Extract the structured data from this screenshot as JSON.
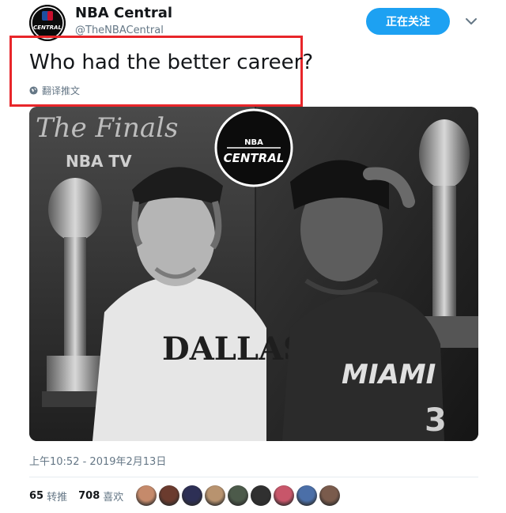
{
  "profile": {
    "display_name": "NBA Central",
    "handle": "@TheNBACentral",
    "avatar_text": "CENTRAL",
    "avatar_logo": "NBA"
  },
  "follow_button": {
    "label": "正在关注"
  },
  "menu": {
    "icon": "chevron-down-icon"
  },
  "tweet": {
    "text": "Who had the better career?",
    "translate_label": "翻译推文",
    "translate_icon": "globe-icon"
  },
  "media": {
    "left_banner": "The Finals",
    "left_tv": "NBA TV",
    "left_jersey": "DALLAS",
    "right_jersey": "MIAMI",
    "right_number": "3",
    "logo_top": "NBA",
    "logo_bottom": "CENTRAL"
  },
  "meta": {
    "timestamp": "上午10:52 - 2019年2月13日"
  },
  "stats": {
    "retweets_count": "65",
    "retweets_label": "转推",
    "likes_count": "708",
    "likes_label": "喜欢"
  },
  "likers": [
    "#c58a6b",
    "#6b3b2e",
    "#2d2f55",
    "#b8936f",
    "#4c5a4a",
    "#303030",
    "#c8566a",
    "#4b6fa8",
    "#7a5b4c"
  ],
  "colors": {
    "accent": "#1da1f2",
    "highlight_box": "#e8262a",
    "muted_text": "#657786"
  }
}
